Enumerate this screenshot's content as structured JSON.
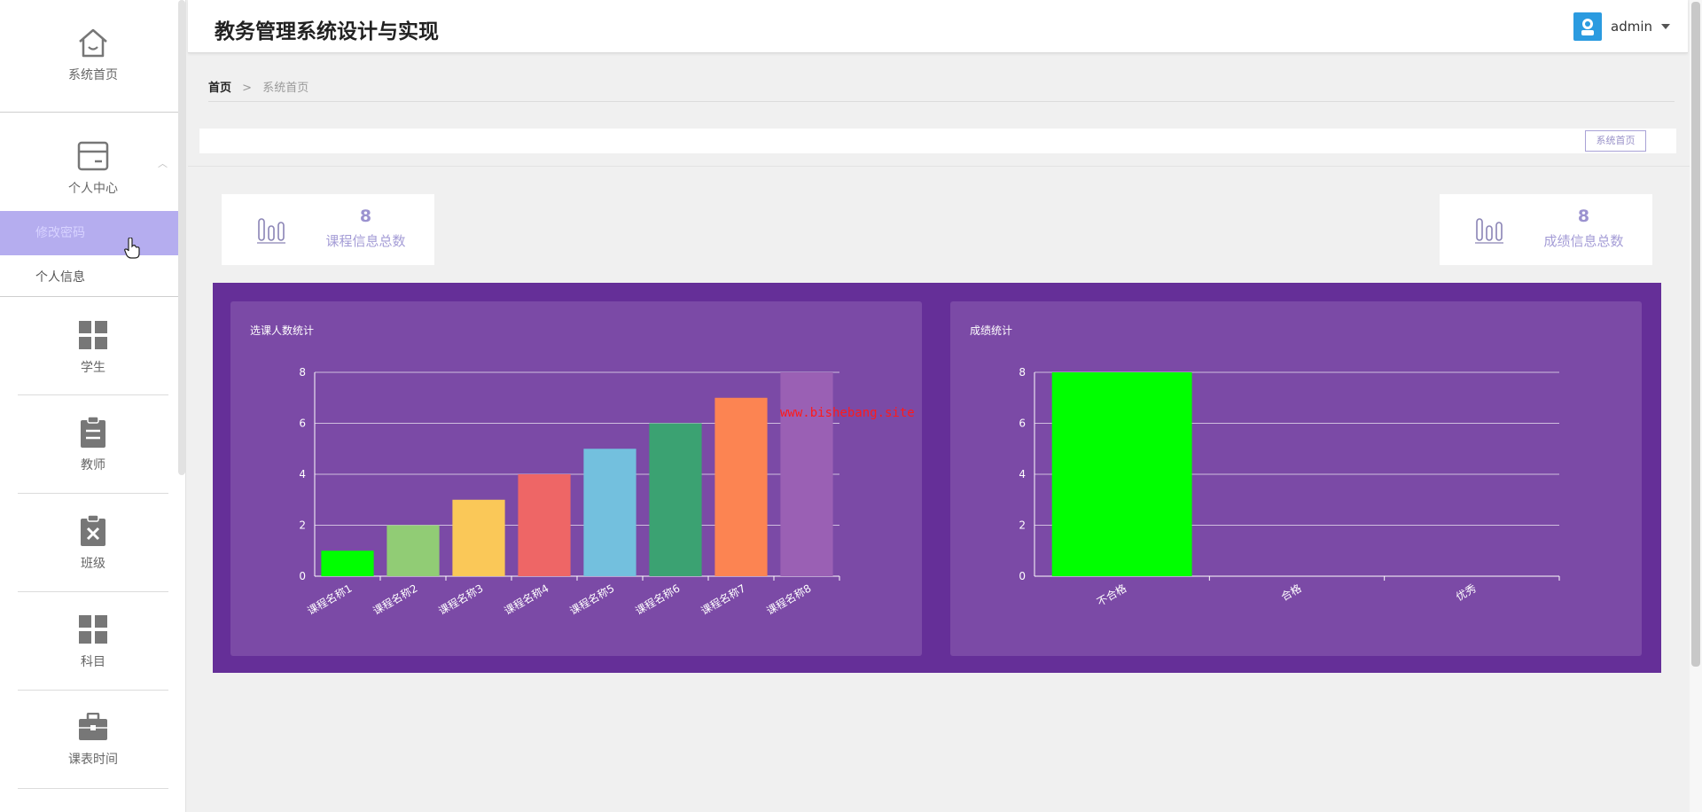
{
  "sidebar": {
    "home": {
      "label": "系统首页",
      "icon": "home-icon"
    },
    "personal": {
      "label": "个人中心",
      "icon": "card-icon",
      "sub": [
        {
          "label": "修改密码"
        },
        {
          "label": "个人信息"
        }
      ]
    },
    "items": [
      {
        "label": "学生",
        "icon": "grid-icon"
      },
      {
        "label": "教师",
        "icon": "clipboard-icon"
      },
      {
        "label": "班级",
        "icon": "clipboard-x-icon"
      },
      {
        "label": "科目",
        "icon": "grid-icon"
      },
      {
        "label": "课表时间",
        "icon": "briefcase-icon"
      }
    ]
  },
  "header": {
    "title": "教务管理系统设计与实现",
    "user": "admin"
  },
  "breadcrumb": {
    "home": "首页",
    "separator": ">",
    "current": "系统首页"
  },
  "tabs": [
    {
      "label": "系统首页"
    }
  ],
  "stats": [
    {
      "value": "8",
      "label": "课程信息总数"
    },
    {
      "value": "8",
      "label": "成绩信息总数"
    }
  ],
  "watermark": "www.bishebang.site",
  "colors": {
    "panel": "#652f98",
    "card": "#7b4aa6",
    "accent": "#9b92cf",
    "active_menu": "#b5adef"
  },
  "chart_data": [
    {
      "type": "bar",
      "title": "选课人数统计",
      "categories": [
        "课程名称1",
        "课程名称2",
        "课程名称3",
        "课程名称4",
        "课程名称5",
        "课程名称6",
        "课程名称7",
        "课程名称8"
      ],
      "values": [
        1,
        2,
        3,
        4,
        5,
        6,
        7,
        8
      ],
      "colors": [
        "#00ff00",
        "#91cc75",
        "#fac858",
        "#ee6666",
        "#73c0de",
        "#3ba272",
        "#fc8452",
        "#9a60b4"
      ],
      "ylim": [
        0,
        8
      ],
      "yticks": [
        0,
        2,
        4,
        6,
        8
      ],
      "grid": true
    },
    {
      "type": "bar",
      "title": "成绩统计",
      "categories": [
        "不合格",
        "合格",
        "优秀"
      ],
      "values": [
        8,
        0,
        0
      ],
      "colors": [
        "#00ff00",
        "#00ff00",
        "#00ff00"
      ],
      "ylim": [
        0,
        8
      ],
      "yticks": [
        0,
        2,
        4,
        6,
        8
      ],
      "grid": true
    }
  ]
}
